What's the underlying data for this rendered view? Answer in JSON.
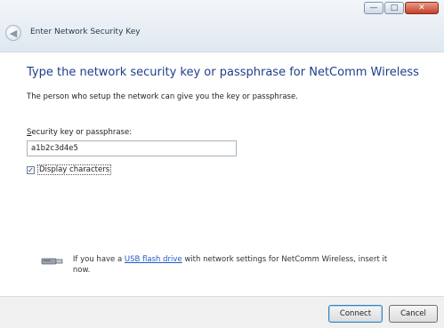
{
  "window": {
    "title": "Enter Network Security Key",
    "controls": {
      "minimize": "—",
      "maximize": "□",
      "close": "✕"
    }
  },
  "main": {
    "heading": "Type the network security key or passphrase for NetComm Wireless",
    "description": "The person who setup the network can give you the key or passphrase.",
    "field_label": "Security key or passphrase:",
    "field_label_accesskey": "S",
    "field_label_rest": "ecurity key or passphrase:",
    "key_value": "a1b2c3d4e5",
    "display_checked": true,
    "display_label": "Display characters"
  },
  "usb": {
    "icon": "usb-flash-drive-icon",
    "text_before": "If you have a ",
    "link": "USB flash drive",
    "text_after": " with network settings for NetComm Wireless, insert it now."
  },
  "footer": {
    "connect_label": "Connect",
    "cancel_label": "Cancel"
  },
  "colors": {
    "heading": "#1e3f8a",
    "link": "#1e5bc6",
    "close": "#c5402a"
  }
}
